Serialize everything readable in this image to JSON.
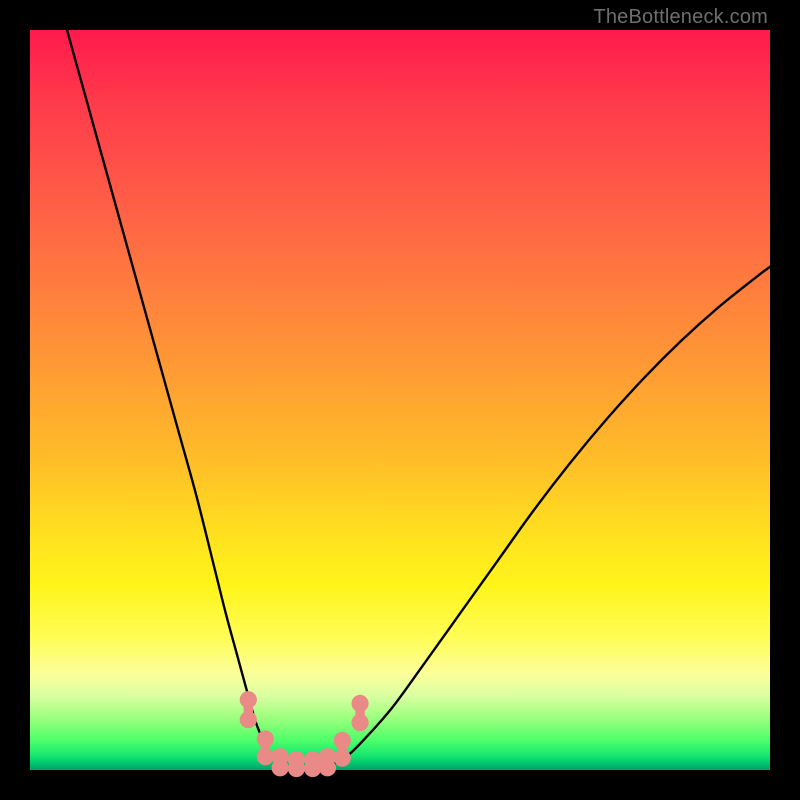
{
  "attribution": "TheBottleneck.com",
  "colors": {
    "curve": "#000000",
    "dumbbell_fill": "#e98a86",
    "background_black": "#000000"
  },
  "chart_data": {
    "type": "line",
    "title": "",
    "xlabel": "",
    "ylabel": "",
    "xlim": [
      0,
      100
    ],
    "ylim": [
      0,
      100
    ],
    "grid": false,
    "legend": false,
    "note": "V-shaped bottleneck curve; values are approximate percentages read from the plot. x is horizontal position, y is vertical height of the curve above the baseline (0 = bottom, 100 = top).",
    "series": [
      {
        "name": "left-branch",
        "x": [
          5,
          7.5,
          10,
          12.5,
          15,
          17.5,
          20,
          22.5,
          25,
          26.5,
          28,
          29.5,
          30.5,
          31.5,
          32.5,
          33.5
        ],
        "y": [
          100,
          91,
          82,
          73,
          64,
          55,
          46,
          37,
          27,
          21,
          15.5,
          10,
          6.5,
          4,
          2,
          1
        ]
      },
      {
        "name": "valley-floor",
        "x": [
          33.5,
          35,
          36.5,
          38,
          39.5,
          41
        ],
        "y": [
          1,
          0.5,
          0.4,
          0.4,
          0.5,
          0.8
        ]
      },
      {
        "name": "right-branch",
        "x": [
          41,
          43,
          45.5,
          49,
          53,
          58,
          63,
          68,
          73,
          78,
          83,
          88,
          93,
          98,
          100
        ],
        "y": [
          0.8,
          2,
          4.5,
          8.5,
          14,
          21,
          28,
          35,
          41.5,
          47.5,
          53,
          58,
          62.5,
          66.5,
          68
        ]
      }
    ],
    "markers": {
      "name": "dumbbell-points",
      "shape": "double-circle",
      "points": [
        {
          "x": 29.5,
          "y_top": 9.5,
          "y_bot": 6.8
        },
        {
          "x": 31.8,
          "y_top": 4.2,
          "y_bot": 1.8
        },
        {
          "x": 33.8,
          "y_top": 1.8,
          "y_bot": 0.3
        },
        {
          "x": 36.0,
          "y_top": 1.4,
          "y_bot": 0.2
        },
        {
          "x": 38.2,
          "y_top": 1.4,
          "y_bot": 0.2
        },
        {
          "x": 40.2,
          "y_top": 1.8,
          "y_bot": 0.3
        },
        {
          "x": 42.2,
          "y_top": 4.0,
          "y_bot": 1.6
        },
        {
          "x": 44.6,
          "y_top": 9.0,
          "y_bot": 6.4
        }
      ]
    }
  }
}
